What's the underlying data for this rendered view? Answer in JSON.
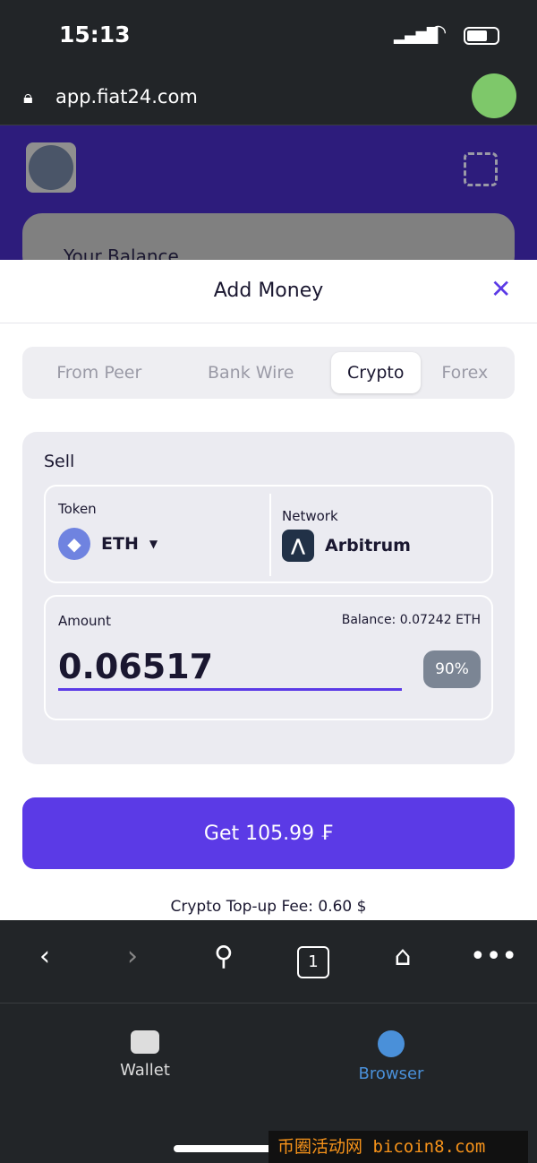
{
  "status_bar": {
    "time": "15:13"
  },
  "browser": {
    "url": "app.fiat24.com",
    "tab_count": "1"
  },
  "background": {
    "balance_label": "Your Balance"
  },
  "sheet": {
    "title": "Add Money",
    "tabs": [
      {
        "label": "From Peer",
        "active": false
      },
      {
        "label": "Bank Wire",
        "active": false
      },
      {
        "label": "Crypto",
        "active": true
      },
      {
        "label": "Forex",
        "active": false
      }
    ],
    "sell_label": "Sell",
    "token_label": "Token",
    "token_value": "ETH",
    "network_label": "Network",
    "network_value": "Arbitrum",
    "amount_label": "Amount",
    "balance_text": "Balance: 0.07242 ETH",
    "amount_value": "0.06517",
    "percent_chip": "90%",
    "get_button": "Get 105.99 ₣",
    "fee_text_label": "Crypto Top-up Fee:",
    "fee_text_value": "0.60 $"
  },
  "bottom_nav": [
    {
      "label": "Wallet",
      "active": false
    },
    {
      "label": "Browser",
      "active": true
    }
  ],
  "watermark": "币圈活动网 bicoin8.com",
  "colors": {
    "accent": "#5b3ae6",
    "header": "#2d1c7c",
    "active_nav": "#4a90d9"
  }
}
